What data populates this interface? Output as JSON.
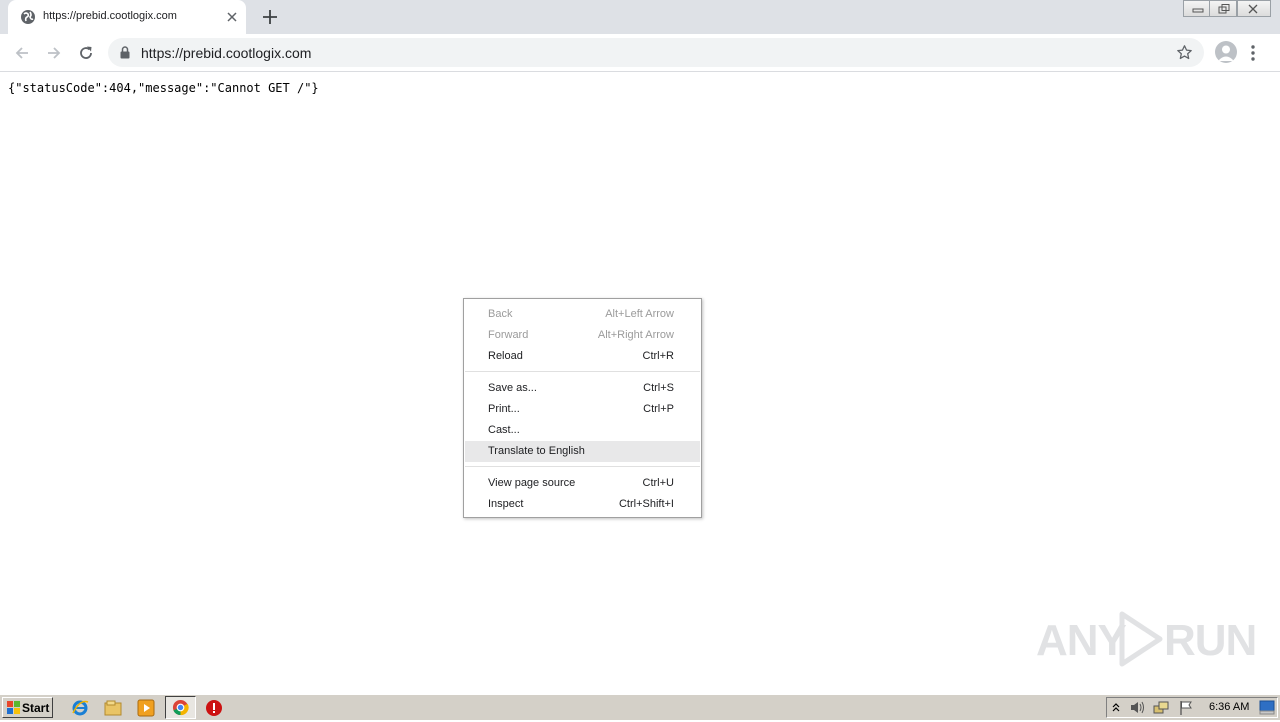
{
  "browser": {
    "tab": {
      "title": "https://prebid.cootlogix.com"
    },
    "address_bar": {
      "url": "https://prebid.cootlogix.com"
    }
  },
  "page": {
    "body_text": "{\"statusCode\":404,\"message\":\"Cannot GET /\"}"
  },
  "context_menu": {
    "items": [
      {
        "label": "Back",
        "shortcut": "Alt+Left Arrow",
        "disabled": true
      },
      {
        "label": "Forward",
        "shortcut": "Alt+Right Arrow",
        "disabled": true
      },
      {
        "label": "Reload",
        "shortcut": "Ctrl+R",
        "disabled": false
      },
      {
        "label": "Save as...",
        "shortcut": "Ctrl+S",
        "disabled": false
      },
      {
        "label": "Print...",
        "shortcut": "Ctrl+P",
        "disabled": false
      },
      {
        "label": "Cast...",
        "shortcut": "",
        "disabled": false
      },
      {
        "label": "Translate to English",
        "shortcut": "",
        "disabled": false,
        "highlighted": true
      },
      {
        "label": "View page source",
        "shortcut": "Ctrl+U",
        "disabled": false
      },
      {
        "label": "Inspect",
        "shortcut": "Ctrl+Shift+I",
        "disabled": false
      }
    ]
  },
  "watermark": {
    "left": "ANY",
    "right": "RUN"
  },
  "taskbar": {
    "start_label": "Start",
    "clock": "6:36 AM"
  },
  "icons": {
    "tab_favicon": "globe-icon",
    "tab_close": "close-icon",
    "new_tab": "plus-icon",
    "back": "arrow-left-icon",
    "forward": "arrow-right-icon",
    "reload": "reload-icon",
    "lock": "lock-icon",
    "bookmark": "star-icon",
    "profile": "avatar-icon",
    "menu": "kebab-menu-icon"
  },
  "colors": {
    "titlebar": "#dee1e6",
    "omnibox": "#f1f3f4",
    "taskbar": "#d4d0c8",
    "menu_highlight": "#e8e8e9"
  }
}
